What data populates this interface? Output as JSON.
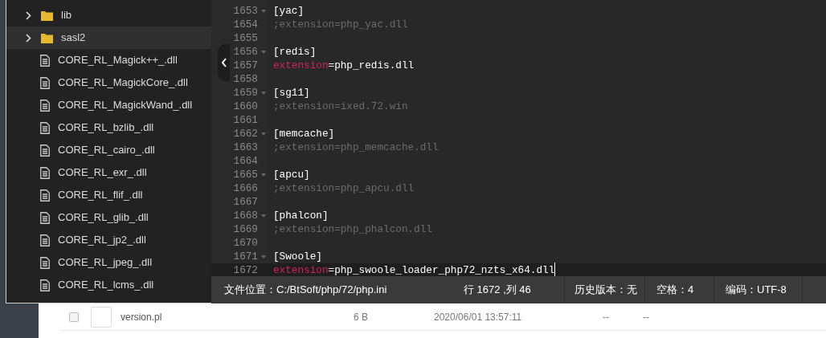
{
  "sidebar": {
    "items": [
      {
        "kind": "folder",
        "name": "lib",
        "selected": false
      },
      {
        "kind": "folder",
        "name": "sasl2",
        "selected": true
      },
      {
        "kind": "file",
        "name": "CORE_RL_Magick++_.dll",
        "selected": false
      },
      {
        "kind": "file",
        "name": "CORE_RL_MagickCore_.dll",
        "selected": false
      },
      {
        "kind": "file",
        "name": "CORE_RL_MagickWand_.dll",
        "selected": false
      },
      {
        "kind": "file",
        "name": "CORE_RL_bzlib_.dll",
        "selected": false
      },
      {
        "kind": "file",
        "name": "CORE_RL_cairo_.dll",
        "selected": false
      },
      {
        "kind": "file",
        "name": "CORE_RL_exr_.dll",
        "selected": false
      },
      {
        "kind": "file",
        "name": "CORE_RL_flif_.dll",
        "selected": false
      },
      {
        "kind": "file",
        "name": "CORE_RL_glib_.dll",
        "selected": false
      },
      {
        "kind": "file",
        "name": "CORE_RL_jp2_.dll",
        "selected": false
      },
      {
        "kind": "file",
        "name": "CORE_RL_jpeg_.dll",
        "selected": false
      },
      {
        "kind": "file",
        "name": "CORE_RL_lcms_.dll",
        "selected": false
      }
    ]
  },
  "editor": {
    "lines": [
      {
        "number": "1653",
        "kind": "section",
        "text": "[yac]",
        "current": false
      },
      {
        "number": "1654",
        "kind": "comment",
        "text": ";extension=php_yac.dll",
        "current": false
      },
      {
        "number": "1655",
        "kind": "blank",
        "current": false
      },
      {
        "number": "1656",
        "kind": "section",
        "text": "[redis]",
        "current": false
      },
      {
        "number": "1657",
        "kind": "directive",
        "key": "extension",
        "text": "=php_redis.dll",
        "current": false
      },
      {
        "number": "1658",
        "kind": "blank",
        "current": false
      },
      {
        "number": "1659",
        "kind": "section",
        "text": "[sg11]",
        "current": false
      },
      {
        "number": "1660",
        "kind": "comment",
        "text": ";extension=ixed.72.win",
        "current": false
      },
      {
        "number": "1661",
        "kind": "blank",
        "current": false
      },
      {
        "number": "1662",
        "kind": "section",
        "text": "[memcache]",
        "current": false
      },
      {
        "number": "1663",
        "kind": "comment",
        "text": ";extension=php_memcache.dll",
        "current": false
      },
      {
        "number": "1664",
        "kind": "blank",
        "current": false
      },
      {
        "number": "1665",
        "kind": "section",
        "text": "[apcu]",
        "current": false
      },
      {
        "number": "1666",
        "kind": "comment",
        "text": ";extension=php_apcu.dll",
        "current": false
      },
      {
        "number": "1667",
        "kind": "blank",
        "current": false
      },
      {
        "number": "1668",
        "kind": "section",
        "text": "[phalcon]",
        "current": false
      },
      {
        "number": "1669",
        "kind": "comment",
        "text": ";extension=php_phalcon.dll",
        "current": false
      },
      {
        "number": "1670",
        "kind": "blank",
        "current": false
      },
      {
        "number": "1671",
        "kind": "section",
        "text": "[Swoole]",
        "current": false
      },
      {
        "number": "1672",
        "kind": "directive",
        "key": "extension",
        "text": "=php_swoole_loader_php72_nzts_x64.dll",
        "current": true
      }
    ]
  },
  "status_bar": {
    "file_location": "文件位置：C:/BtSoft/php/72/php.ini",
    "cursor": "行 1672 ,列 46",
    "history": "历史版本：无",
    "indent": "空格：4",
    "encoding": "编码：UTF-8"
  },
  "file_row": {
    "checked": false,
    "name": "version.pl",
    "size": "6 B",
    "date": "2020/06/01 13:57:11",
    "column_4": "--",
    "column_5": "--"
  }
}
